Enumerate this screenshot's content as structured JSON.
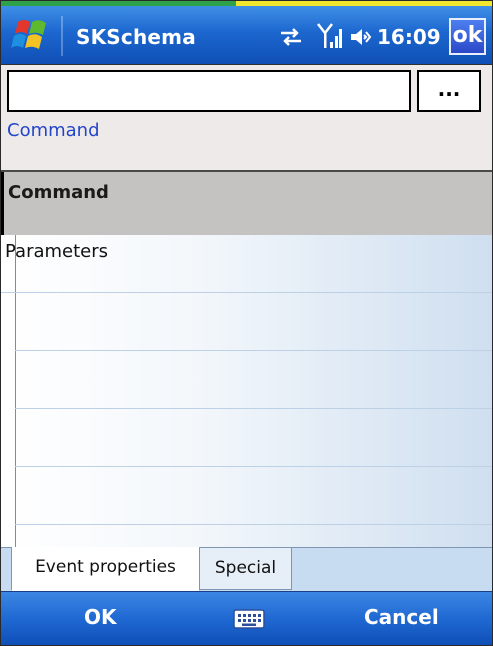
{
  "statusbar": {
    "app_title": "SKSchema",
    "time": "16:09",
    "ok_label": "ok",
    "icons": [
      "windows-start-icon",
      "sync-icon",
      "signal-icon",
      "volume-icon"
    ]
  },
  "command_area": {
    "input_value": "",
    "browse_label": "...",
    "caption": "Command"
  },
  "grid": {
    "header": "Command",
    "rows": [
      "Parameters",
      "",
      "",
      "",
      ""
    ]
  },
  "tabs": {
    "active": "Event properties",
    "inactive": "Special"
  },
  "softkeys": {
    "left": "OK",
    "right": "Cancel",
    "center_icon": "keyboard-icon"
  },
  "colors": {
    "titlebar_blue": "#1c67cf",
    "caption_blue": "#2346c8",
    "header_gray": "#c5c2c2",
    "input_bg": "#efeaea"
  }
}
